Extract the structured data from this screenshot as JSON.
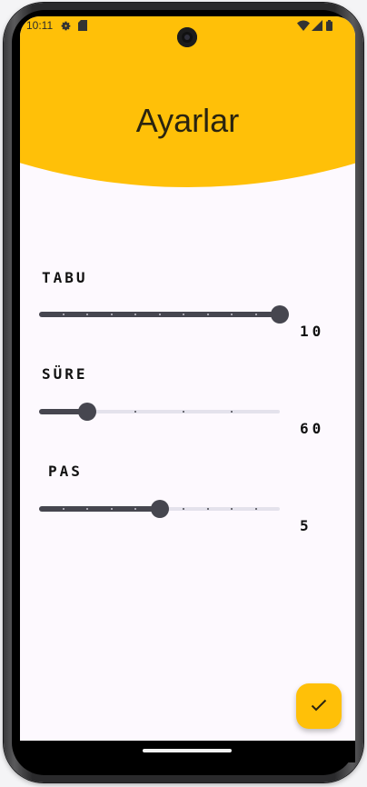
{
  "status_bar": {
    "time": "10:11",
    "icons": [
      "settings-gear-icon",
      "sim-card-icon",
      "wifi-icon",
      "signal-icon",
      "battery-icon"
    ]
  },
  "header": {
    "title": "Ayarlar",
    "color": "#ffc008"
  },
  "settings": [
    {
      "label": "TABU",
      "value": "10",
      "min": 1,
      "max": 10,
      "current": 10,
      "steps": 10
    },
    {
      "label": "SÜRE",
      "value": "60",
      "min": 30,
      "max": 180,
      "current": 60,
      "steps": 5
    },
    {
      "label": "PAS",
      "value": "5",
      "min": 0,
      "max": 10,
      "current": 5,
      "steps": 10
    }
  ],
  "fab": {
    "icon": "check-icon",
    "color": "#ffc008"
  },
  "colors": {
    "slider_active": "#46464f",
    "slider_inactive": "#e4e2ec",
    "background": "#fdf9fe"
  }
}
